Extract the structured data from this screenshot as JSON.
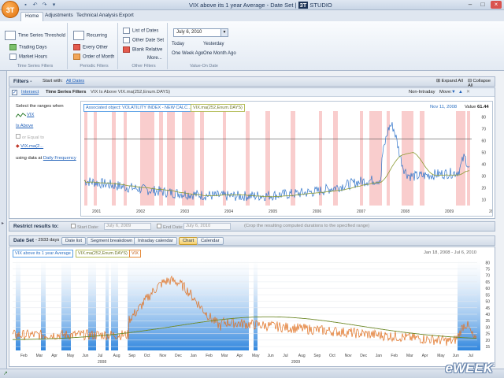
{
  "window": {
    "title": "VIX above its 1 year Average - Date Set |",
    "brand": "STUDIO",
    "logo": "3T"
  },
  "tabs": [
    "Home",
    "Adjustments",
    "Technical Analysis",
    "Export"
  ],
  "ribbon": {
    "time_series": {
      "main": "Time Series Threshold",
      "items": [
        "Trading Days",
        "Market Hours"
      ],
      "label": "Time Series Filters"
    },
    "periodic": {
      "items": [
        "Recurring",
        "Every Other",
        "Order of Month"
      ],
      "label": "Periodic Filters"
    },
    "other": {
      "items": [
        "List of Dates",
        "Other Date Set",
        "Blank Relative",
        "More..."
      ],
      "label": "Other Filters"
    },
    "value_on_date": {
      "date": "July 6, 2010",
      "quick": [
        "Today",
        "Yesterday",
        "One Week Ago",
        "One Month Ago"
      ],
      "label": "Value-On Date"
    }
  },
  "filters_bar": {
    "title": "Filters -",
    "start_with_label": "Start with:",
    "start_with_value": "All Dates",
    "expand": "Expand All",
    "collapse": "Collapse All"
  },
  "ts_filter": {
    "checkbox_label": "Intersect",
    "title": "Time Series Filters",
    "expr": "VIX Is Above VIX.ma(252,Enum.DAYS)",
    "non_intraday": "Non-Intraday",
    "move": "Move:",
    "select_text": "Select the ranges when",
    "series_a": "VIX",
    "condition": "Is Above",
    "equal_text": "or Equal to",
    "series_b": "VIX.ma(2...",
    "using_text": "using data at",
    "frequency": "Daily Frequency"
  },
  "top_chart": {
    "legend_a": "Associated object: VOLATILITY INDEX - NEW CALC...",
    "legend_b": "VIX.ma(252,Enum.DAYS)",
    "cursor_date": "Nov 11, 2008",
    "value_label": "Value",
    "value": "61.44",
    "y_ticks": [
      "80",
      "70",
      "60",
      "50",
      "40",
      "30",
      "20",
      "10"
    ],
    "x_ticks": [
      "2001",
      "2002",
      "2003",
      "2004",
      "2005",
      "2006",
      "2007",
      "2008",
      "2009",
      "20"
    ]
  },
  "restrict": {
    "title": "Restrict results to:",
    "start_label": "Start Date:",
    "start_value": "July 6, 2009",
    "end_label": "End Date:",
    "end_value": "July 6, 2010",
    "note": "(Crop the resulting computed durations to the specified range)"
  },
  "dateset": {
    "title": "Date Set",
    "count": "- 2933 days",
    "buttons": [
      "Date list",
      "Segment breakdown",
      "Intraday calendar",
      "Chart",
      "Calendar"
    ],
    "active_button": "Chart"
  },
  "bottom_chart": {
    "legend": [
      "VIX above its 1 year Average",
      "VIX.ma(252,Enum.DAYS)",
      "VIX"
    ],
    "range": "Jan 18, 2008  -  Jul 6, 2010",
    "y_ticks": [
      "80",
      "75",
      "70",
      "65",
      "60",
      "55",
      "50",
      "45",
      "40",
      "35",
      "30",
      "25",
      "20",
      "15"
    ],
    "x_ticks": [
      "Feb",
      "Mar",
      "Apr",
      "May",
      "Jun",
      "Jul",
      "Aug",
      "Sep",
      "Oct",
      "Nov",
      "Dec",
      "Jan",
      "Feb",
      "Mar",
      "Apr",
      "May",
      "Jun",
      "Jul",
      "Aug",
      "Sep",
      "Oct",
      "Nov",
      "Dec",
      "Jan",
      "Feb",
      "Mar",
      "Apr",
      "May",
      "Jun",
      "Jul"
    ],
    "year_labels": [
      "2008",
      "2009"
    ]
  },
  "watermark": "eWEEK",
  "colors": {
    "accent": "#1f5fb8",
    "highlight_red": "#f7b9b9",
    "highlight_blue": "#3f8fe0",
    "vix_line": "#e07020",
    "ma_line": "#6f8a2a"
  }
}
